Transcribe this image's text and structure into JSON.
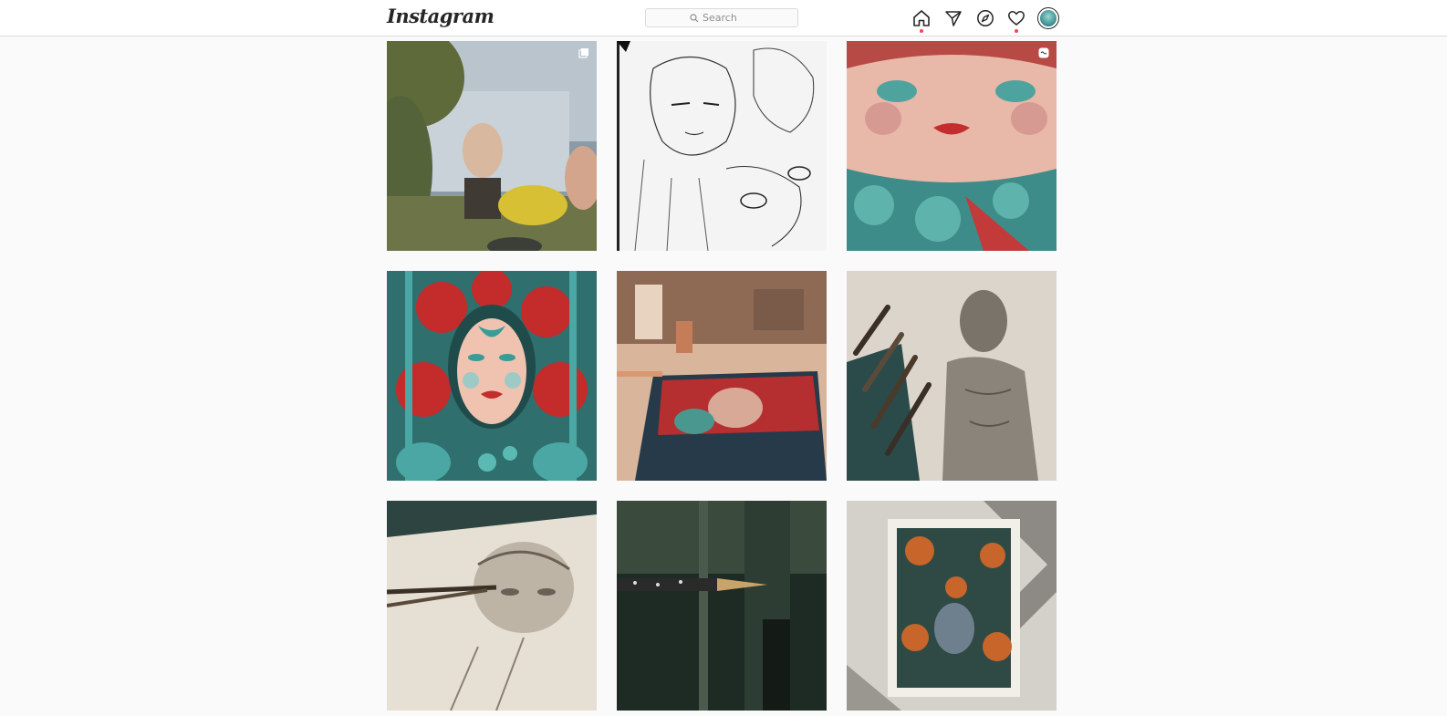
{
  "app": {
    "logo_text": "Instagram"
  },
  "search": {
    "placeholder": "Search"
  },
  "nav": {
    "icons": [
      "home-icon",
      "direct-icon",
      "explore-icon",
      "activity-icon",
      "avatar"
    ],
    "notification_color": "#ed4956"
  },
  "grid": {
    "posts": [
      {
        "subject": "garden-family-painting",
        "badge": "multiple-posts-icon"
      },
      {
        "subject": "anime-sketch"
      },
      {
        "subject": "face-painting-closeup",
        "badge": "reel-icon"
      },
      {
        "subject": "red-teal-face-painting"
      },
      {
        "subject": "painting-on-desk"
      },
      {
        "subject": "pencil-figure-drawing"
      },
      {
        "subject": "pencil-face-drawing"
      },
      {
        "subject": "pencil-tip-closeup"
      },
      {
        "subject": "framed-painting-in-light"
      }
    ]
  },
  "colors": {
    "background": "#fafafa",
    "topbar": "#ffffff",
    "border": "#dbdbdb",
    "text": "#262626",
    "muted": "#8e8e8e"
  }
}
